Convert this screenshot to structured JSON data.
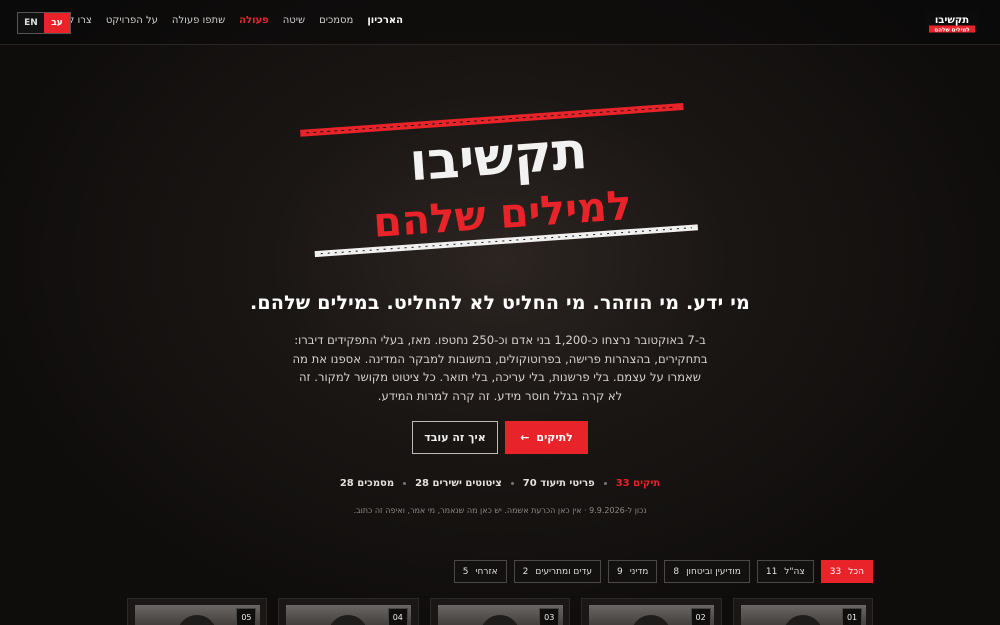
{
  "brand": {
    "logo_top": "תקשיבו",
    "logo_bottom": "למילים שלהם",
    "accent_color": "#e8232a"
  },
  "nav": {
    "items": [
      {
        "label": "הארכיון",
        "state": "current"
      },
      {
        "label": "מסמכים",
        "state": "normal"
      },
      {
        "label": "שיטה",
        "state": "normal"
      },
      {
        "label": "פעולה",
        "state": "highlight"
      },
      {
        "label": "שתפו פעולה",
        "state": "normal"
      },
      {
        "label": "על הפרויקט",
        "state": "normal"
      },
      {
        "label": "צרו קשר",
        "state": "normal"
      }
    ],
    "lang_he": "עב",
    "lang_en": "EN"
  },
  "hero": {
    "title_line1": "תקשיבו",
    "title_line2": "למילים שלהם",
    "tagline": "מי ידע. מי הוזהר. מי החליט לא להחליט. במילים שלהם.",
    "description": "ב-7 באוקטובר נרצחו כ-1,200 בני אדם וכ-250 נחטפו. מאז, בעלי התפקידים דיברו: בתחקירים, בהצהרות פרישה, בפרוטוקולים, בתשובות למבקר המדינה. אספנו את מה שאמרו על עצמם. בלי פרשנות, בלי עריכה, בלי תואר. כל ציטוט מקושר למקור. זה לא קרה בגלל חוסר מידע. זה קרה למרות המידע.",
    "primary_button": "לתיקים",
    "arrow_icon": "←",
    "secondary_button": "איך זה עובד"
  },
  "stats": [
    {
      "label": "33 תיקים",
      "highlight": true
    },
    {
      "label": "70 פריטי תיעוד",
      "highlight": false
    },
    {
      "label": "28 ציטוטים ישירים",
      "highlight": false
    },
    {
      "label": "28 מסמכים",
      "highlight": false
    }
  ],
  "updated_note": "נכון ל-9.9.2026 · אין כאן הכרעת אשמה. יש כאן מה שנאמר, מי אמר, ואיפה זה כתוב.",
  "filters": [
    {
      "label": "הכל",
      "count": "33",
      "active": true
    },
    {
      "label": "צה\"ל",
      "count": "11",
      "active": false
    },
    {
      "label": "מודיעין וביטחון",
      "count": "8",
      "active": false
    },
    {
      "label": "מדיני",
      "count": "9",
      "active": false
    },
    {
      "label": "עדים ומתריעים",
      "count": "2",
      "active": false
    },
    {
      "label": "אזרחי",
      "count": "5",
      "active": false
    }
  ],
  "cards": [
    {
      "num": "01"
    },
    {
      "num": "02"
    },
    {
      "num": "03"
    },
    {
      "num": "04"
    },
    {
      "num": "05"
    }
  ]
}
